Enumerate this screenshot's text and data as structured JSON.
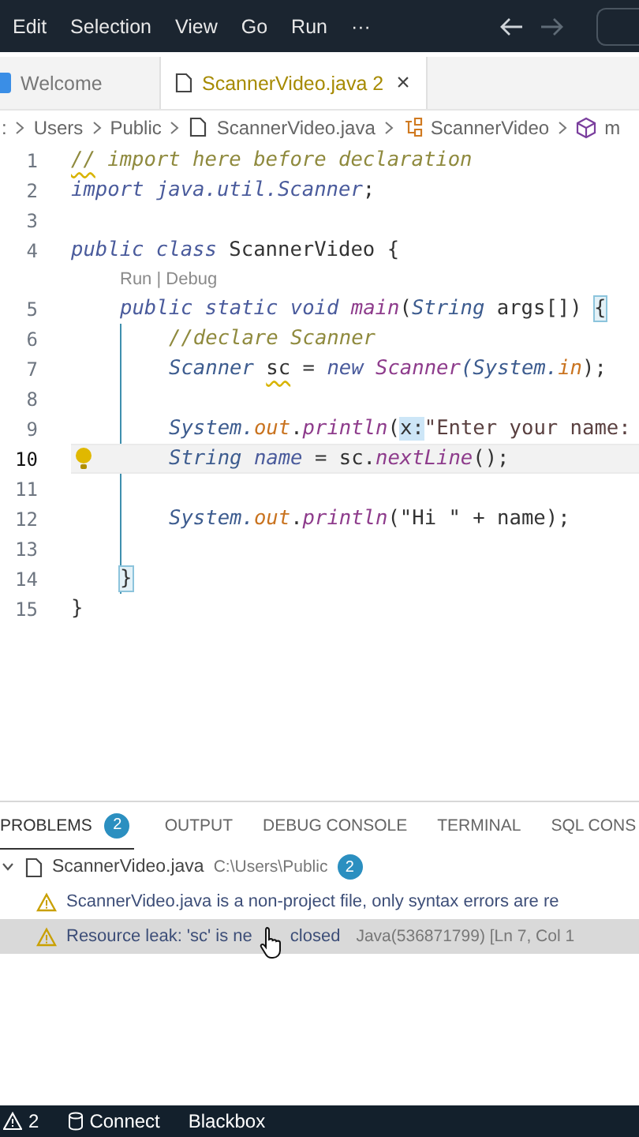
{
  "menu": {
    "items": [
      "Edit",
      "Selection",
      "View",
      "Go",
      "Run",
      "···"
    ]
  },
  "nav": {
    "back_disabled": false,
    "forward_disabled": true
  },
  "tabs": [
    {
      "label": "Welcome",
      "selected": false,
      "warning": false
    },
    {
      "label": "ScannerVideo.java 2",
      "selected": true,
      "warning": true,
      "close": "×"
    }
  ],
  "breadcrumbs": [
    {
      "text": ":",
      "kind": "folder"
    },
    {
      "text": "Users",
      "kind": "folder"
    },
    {
      "text": "Public",
      "kind": "folder"
    },
    {
      "text": "ScannerVideo.java",
      "kind": "file"
    },
    {
      "text": "ScannerVideo",
      "kind": "class"
    },
    {
      "text": "m",
      "kind": "method"
    }
  ],
  "editor": {
    "lines": [
      {
        "number": "1",
        "current": false,
        "tokens": [
          {
            "text": "//",
            "kind": "warncomment"
          },
          {
            "text": " import here before declaration",
            "kind": "comment"
          }
        ]
      },
      {
        "number": "2",
        "current": false,
        "tokens": [
          {
            "text": "import ",
            "kind": "kw"
          },
          {
            "text": "java.util.Scanner",
            "kind": "ns"
          },
          {
            "text": ";",
            "kind": "punct"
          }
        ]
      },
      {
        "number": "3",
        "current": false
      },
      {
        "number": "4",
        "current": false,
        "tokens": [
          {
            "text": "public class ",
            "kind": "kw"
          },
          {
            "text": "ScannerVideo {",
            "kind": "plain"
          }
        ],
        "children": [
          {
            "kind": "codelens",
            "text": "Run | Debug"
          },
          {
            "number": "5",
            "current": false,
            "tokens": [
              {
                "text": "public static void ",
                "kind": "kw"
              },
              {
                "text": "main",
                "kind": "fn"
              },
              {
                "text": "(",
                "kind": "punct"
              },
              {
                "text": "String ",
                "kind": "type"
              },
              {
                "text": "args[]) ",
                "kind": "plain"
              },
              {
                "text": "{",
                "kind": "match"
              }
            ],
            "children": [
              {
                "number": "6",
                "current": false,
                "tokens": [
                  {
                    "text": "//declare Scanner",
                    "kind": "comment"
                  }
                ]
              },
              {
                "number": "7",
                "current": false,
                "tokens": [
                  {
                    "text": "Scanner ",
                    "kind": "type"
                  },
                  {
                    "text": "sc",
                    "kind": "warn"
                  },
                  {
                    "text": " = ",
                    "kind": "punct"
                  },
                  {
                    "text": "new ",
                    "kind": "kw"
                  },
                  {
                    "text": "Scanner",
                    "kind": "fn"
                  },
                  {
                    "text": "(System.",
                    "kind": "type"
                  },
                  {
                    "text": "in",
                    "kind": "field"
                  },
                  {
                    "text": ");",
                    "kind": "punct"
                  }
                ]
              },
              {
                "number": "8",
                "current": false
              },
              {
                "number": "9",
                "current": false,
                "tokens": [
                  {
                    "text": "System.",
                    "kind": "type"
                  },
                  {
                    "text": "out",
                    "kind": "field"
                  },
                  {
                    "text": ".",
                    "kind": "punct"
                  },
                  {
                    "text": "println",
                    "kind": "fn"
                  },
                  {
                    "text": "(",
                    "kind": "punct"
                  },
                  {
                    "text": "x:",
                    "kind": "hint"
                  },
                  {
                    "text": "\"Enter your name:",
                    "kind": "str"
                  }
                ]
              },
              {
                "number": "10",
                "current": true,
                "tokens": [
                  {
                    "text": "String ",
                    "kind": "type"
                  },
                  {
                    "text": "name",
                    "kind": "var"
                  },
                  {
                    "text": " = sc.",
                    "kind": "plain"
                  },
                  {
                    "text": "nextLine",
                    "kind": "fn"
                  },
                  {
                    "text": "();",
                    "kind": "punct"
                  }
                ]
              },
              {
                "number": "11",
                "current": false
              },
              {
                "number": "12",
                "current": false,
                "tokens": [
                  {
                    "text": "System.",
                    "kind": "type"
                  },
                  {
                    "text": "out",
                    "kind": "field"
                  },
                  {
                    "text": ".",
                    "kind": "punct"
                  },
                  {
                    "text": "println",
                    "kind": "fn"
                  },
                  {
                    "text": "(\"Hi \" + name);",
                    "kind": "plain"
                  }
                ]
              },
              {
                "number": "13",
                "current": false
              }
            ]
          },
          {
            "number": "14",
            "current": false,
            "tokens": [
              {
                "text": "}",
                "kind": "match"
              }
            ]
          }
        ]
      },
      {
        "number": "15",
        "current": false,
        "tokens": [
          {
            "text": "}",
            "kind": "plain"
          }
        ]
      }
    ]
  },
  "panel": {
    "tabs": [
      {
        "label": "PROBLEMS",
        "selected": true,
        "badge": "2"
      },
      {
        "label": "OUTPUT",
        "selected": false
      },
      {
        "label": "DEBUG CONSOLE",
        "selected": false
      },
      {
        "label": "TERMINAL",
        "selected": false
      },
      {
        "label": "SQL CONS",
        "selected": false
      }
    ],
    "files": [
      {
        "name": "ScannerVideo.java",
        "path": "C:\\Users\\Public",
        "badge": "2",
        "expanded": true,
        "problems": [
          {
            "message": "ScannerVideo.java is a non-project file, only syntax errors are re",
            "selected": false
          },
          {
            "message": "Resource leak: 'sc' is ne",
            "message_rest": "closed",
            "source": "Java(536871799)  [Ln 7, Col 1",
            "selected": true,
            "cursor": true
          }
        ]
      }
    ]
  },
  "status_bar": {
    "warnings": "2",
    "items": [
      "Connect",
      "Blackbox"
    ]
  }
}
